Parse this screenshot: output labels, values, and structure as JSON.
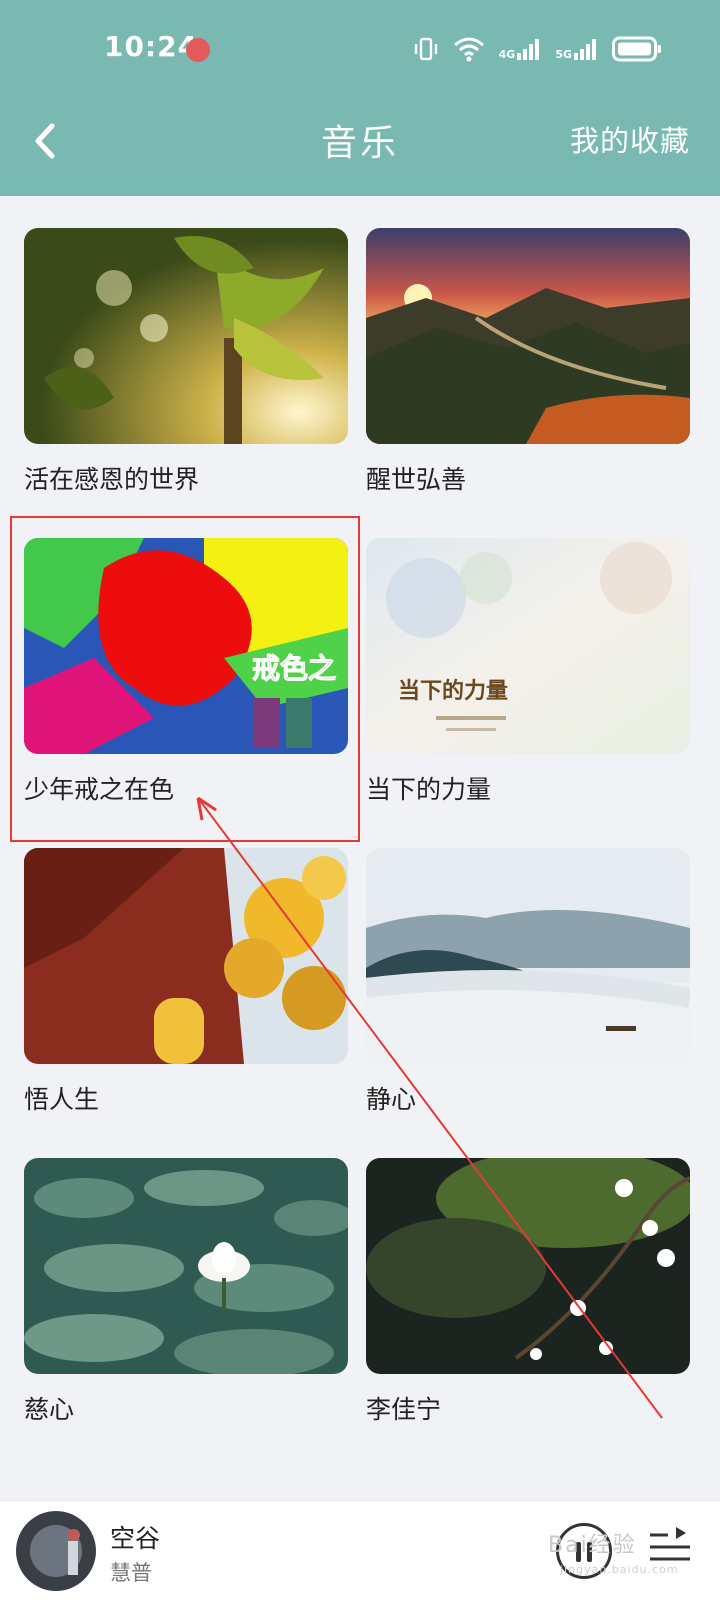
{
  "status_bar": {
    "time": "10:24",
    "network_1": "4G",
    "network_2": "5G",
    "icons": [
      "notification-dot",
      "vibrate-icon",
      "wifi-icon",
      "signal-4g-icon",
      "signal-5g-icon",
      "battery-icon"
    ]
  },
  "header": {
    "back_icon": "chevron-left-icon",
    "title": "音乐",
    "favorites_label": "我的收藏",
    "background": "#79b9b2"
  },
  "albums": [
    {
      "title": "活在感恩的世界"
    },
    {
      "title": "醒世弘善"
    },
    {
      "title": "少年戒之在色",
      "cover_text": "戒色之"
    },
    {
      "title": "当下的力量",
      "cover_text": "当下的力量"
    },
    {
      "title": "悟人生"
    },
    {
      "title": "静心"
    },
    {
      "title": "慈心"
    },
    {
      "title": "李佳宁"
    }
  ],
  "player": {
    "title": "空谷",
    "artist": "慧普",
    "play_icon": "pause-icon",
    "playlist_icon": "playlist-icon"
  },
  "watermark": {
    "text": "Bai经验",
    "sub": "jingyan.baidu.com"
  },
  "annotation": {
    "color": "#e53935"
  }
}
